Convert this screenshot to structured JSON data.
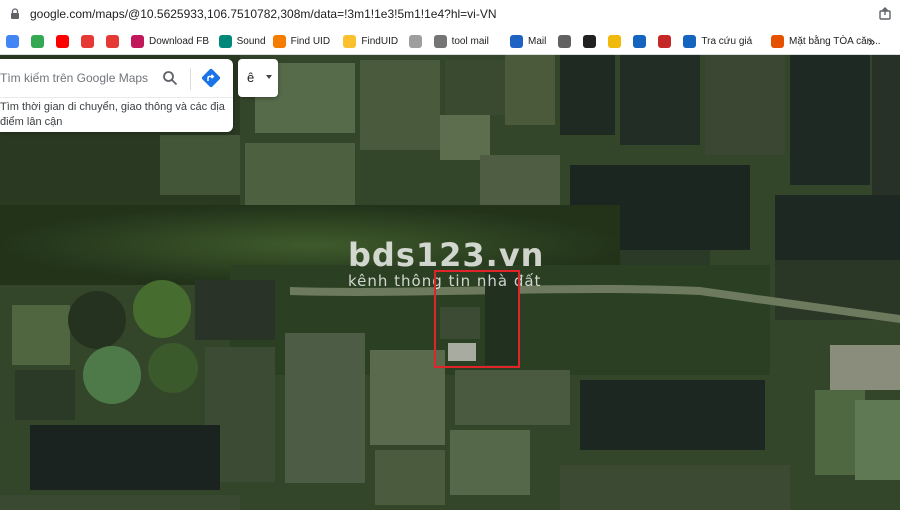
{
  "browser": {
    "url": "google.com/maps/@10.5625933,106.7510782,308m/data=!3m1!1e3!5m1!1e4?hl=vi-VN",
    "bookmarks": [
      {
        "label": "",
        "icon": "google-icon",
        "color": "#4285f4"
      },
      {
        "label": "",
        "icon": "drive-icon",
        "color": "#34a853"
      },
      {
        "label": "",
        "icon": "youtube-icon",
        "color": "#ff0000"
      },
      {
        "label": "",
        "icon": "download-icon",
        "color": "#e53935"
      },
      {
        "label": "",
        "icon": "play-icon",
        "color": "#e53935"
      },
      {
        "label": "Download FB",
        "icon": "download-fb-icon",
        "color": "#c2185b"
      },
      {
        "label": "Sound",
        "icon": "sound-icon",
        "color": "#00897b"
      },
      {
        "label": "Find UID",
        "icon": "find-uid-icon",
        "color": "#f57c00"
      },
      {
        "label": "FindUID",
        "icon": "finduid-icon",
        "color": "#fbc02d"
      },
      {
        "label": "",
        "icon": "page-icon",
        "color": "#9e9e9e"
      },
      {
        "label": "tool mail",
        "icon": "tool-mail-icon",
        "color": "#757575"
      },
      {
        "label": "Mail",
        "icon": "word-mail-icon",
        "color": "#1e63c4"
      },
      {
        "label": "",
        "icon": "bookmark-icon",
        "color": "#616161"
      },
      {
        "label": "",
        "icon": "seventeen-icon",
        "color": "#212121"
      },
      {
        "label": "",
        "icon": "binance-icon",
        "color": "#f0b90b"
      },
      {
        "label": "",
        "icon": "coin-icon",
        "color": "#1565c0"
      },
      {
        "label": "",
        "icon": "flag-icon",
        "color": "#c62828"
      },
      {
        "label": "Tra cứu giá",
        "icon": "chart-icon",
        "color": "#1565c0"
      },
      {
        "label": "Mặt bằng TÒA căn...",
        "icon": "folder-icon",
        "color": "#e65100"
      }
    ],
    "more_label": "»"
  },
  "maps": {
    "search_placeholder": "Tìm kiếm trên Google Maps",
    "hint_line1": "Tìm thời gian di chuyển, giao thông và các địa",
    "hint_line2": "điểm lân cận",
    "language_label": "ê",
    "accent": "#1a73e8"
  },
  "watermark": {
    "title": "bds123.vn",
    "subtitle": "kênh thông tin nhà đất"
  },
  "colors": {
    "highlight": "#e0242a"
  }
}
